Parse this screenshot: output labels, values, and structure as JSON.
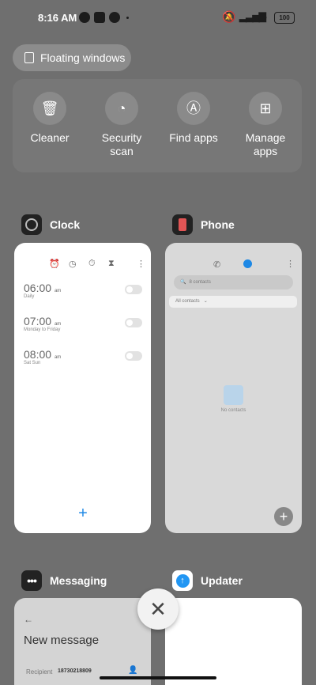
{
  "status_bar": {
    "time": "8:16 AM",
    "battery": "100"
  },
  "floating_windows": {
    "label": "Floating windows"
  },
  "quick_actions": [
    {
      "label": "Cleaner",
      "icon": "trash-icon",
      "glyph": "🗑"
    },
    {
      "label": "Security\nscan",
      "icon": "security-scan-icon",
      "glyph": "◔"
    },
    {
      "label": "Find apps",
      "icon": "find-apps-icon",
      "glyph": "Ⓐ"
    },
    {
      "label": "Manage\napps",
      "icon": "manage-apps-icon",
      "glyph": "⊞"
    }
  ],
  "apps": {
    "clock": {
      "name": "Clock",
      "alarms": [
        {
          "time": "06:00",
          "ampm": "am",
          "sub": "Daily"
        },
        {
          "time": "07:00",
          "ampm": "am",
          "sub": "Monday to Friday"
        },
        {
          "time": "08:00",
          "ampm": "am",
          "sub": "Sat Sun"
        }
      ],
      "add": "+"
    },
    "phone": {
      "name": "Phone",
      "search_placeholder": "8 contacts",
      "filter": "All contacts",
      "empty_text": "No contacts",
      "add": "+"
    },
    "messaging": {
      "name": "Messaging",
      "title": "New message",
      "recipient_label": "Recipient",
      "recipient_value": "18730218809"
    },
    "updater": {
      "name": "Updater"
    }
  },
  "close_all": "✕"
}
